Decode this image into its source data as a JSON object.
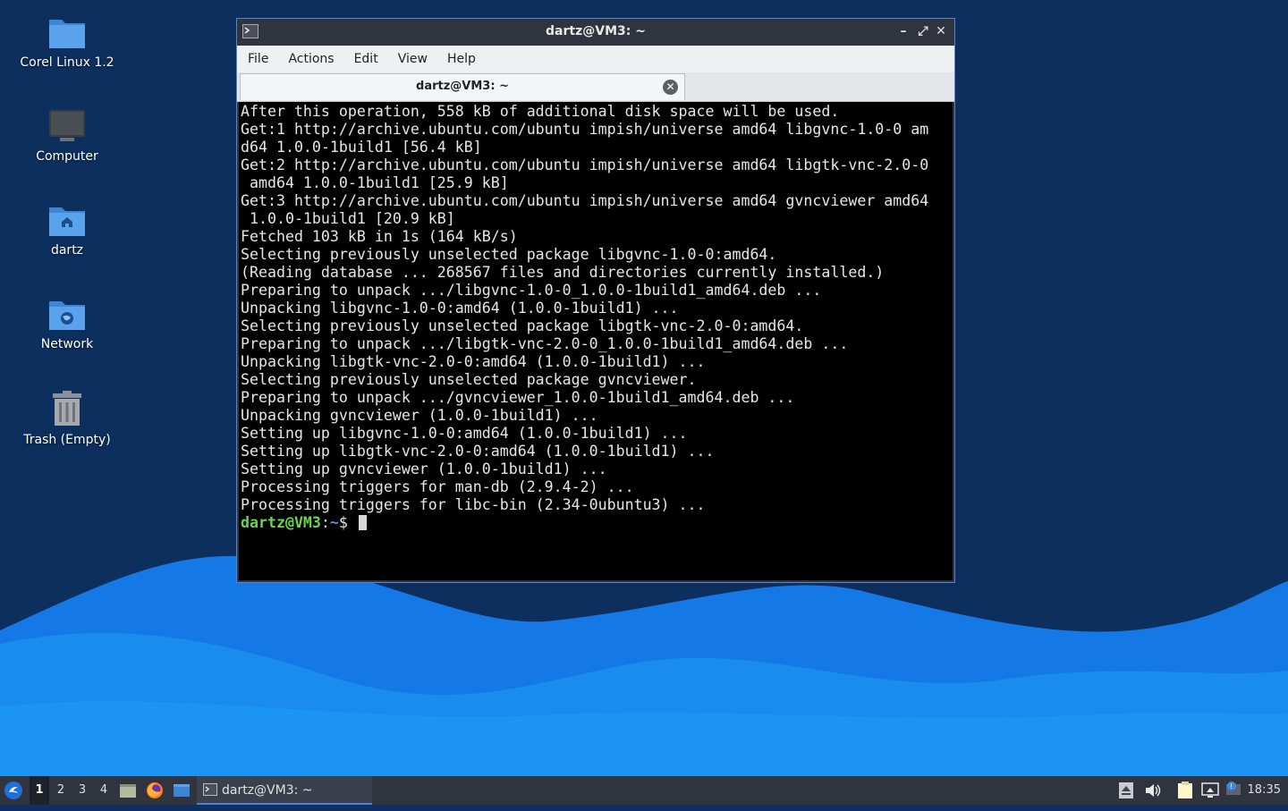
{
  "desktop": {
    "icons": [
      {
        "label": "Corel Linux 1.2",
        "icon": "folder-icon"
      },
      {
        "label": "Computer",
        "icon": "computer-icon"
      },
      {
        "label": "dartz",
        "icon": "home-folder-icon"
      },
      {
        "label": "Network",
        "icon": "network-folder-icon"
      },
      {
        "label": "Trash (Empty)",
        "icon": "trash-icon"
      }
    ]
  },
  "window": {
    "title": "dartz@VM3: ~",
    "menu": [
      "File",
      "Actions",
      "Edit",
      "View",
      "Help"
    ],
    "tab_label": "dartz@VM3: ~",
    "terminal_lines": [
      "After this operation, 558 kB of additional disk space will be used.",
      "Get:1 http://archive.ubuntu.com/ubuntu impish/universe amd64 libgvnc-1.0-0 am",
      "d64 1.0.0-1build1 [56.4 kB]",
      "Get:2 http://archive.ubuntu.com/ubuntu impish/universe amd64 libgtk-vnc-2.0-0",
      " amd64 1.0.0-1build1 [25.9 kB]",
      "Get:3 http://archive.ubuntu.com/ubuntu impish/universe amd64 gvncviewer amd64",
      " 1.0.0-1build1 [20.9 kB]",
      "Fetched 103 kB in 1s (164 kB/s)",
      "Selecting previously unselected package libgvnc-1.0-0:amd64.",
      "(Reading database ... 268567 files and directories currently installed.)",
      "Preparing to unpack .../libgvnc-1.0-0_1.0.0-1build1_amd64.deb ...",
      "Unpacking libgvnc-1.0-0:amd64 (1.0.0-1build1) ...",
      "Selecting previously unselected package libgtk-vnc-2.0-0:amd64.",
      "Preparing to unpack .../libgtk-vnc-2.0-0_1.0.0-1build1_amd64.deb ...",
      "Unpacking libgtk-vnc-2.0-0:amd64 (1.0.0-1build1) ...",
      "Selecting previously unselected package gvncviewer.",
      "Preparing to unpack .../gvncviewer_1.0.0-1build1_amd64.deb ...",
      "Unpacking gvncviewer (1.0.0-1build1) ...",
      "Setting up libgvnc-1.0-0:amd64 (1.0.0-1build1) ...",
      "Setting up libgtk-vnc-2.0-0:amd64 (1.0.0-1build1) ...",
      "Setting up gvncviewer (1.0.0-1build1) ...",
      "Processing triggers for man-db (2.9.4-2) ...",
      "Processing triggers for libc-bin (2.34-0ubuntu3) ..."
    ],
    "prompt": {
      "user_host": "dartz@VM3",
      "sep": ":",
      "path": "~",
      "symbol": "$ "
    }
  },
  "taskbar": {
    "workspaces": [
      "1",
      "2",
      "3",
      "4"
    ],
    "task_label": "dartz@VM3: ~",
    "clock": "18:35"
  },
  "colors": {
    "wallpaper_dark": "#0d3060",
    "wave_light": "#1a8cf0",
    "panel": "#2f343f",
    "prompt_green": "#66d94a",
    "prompt_blue": "#5f8fe0"
  }
}
